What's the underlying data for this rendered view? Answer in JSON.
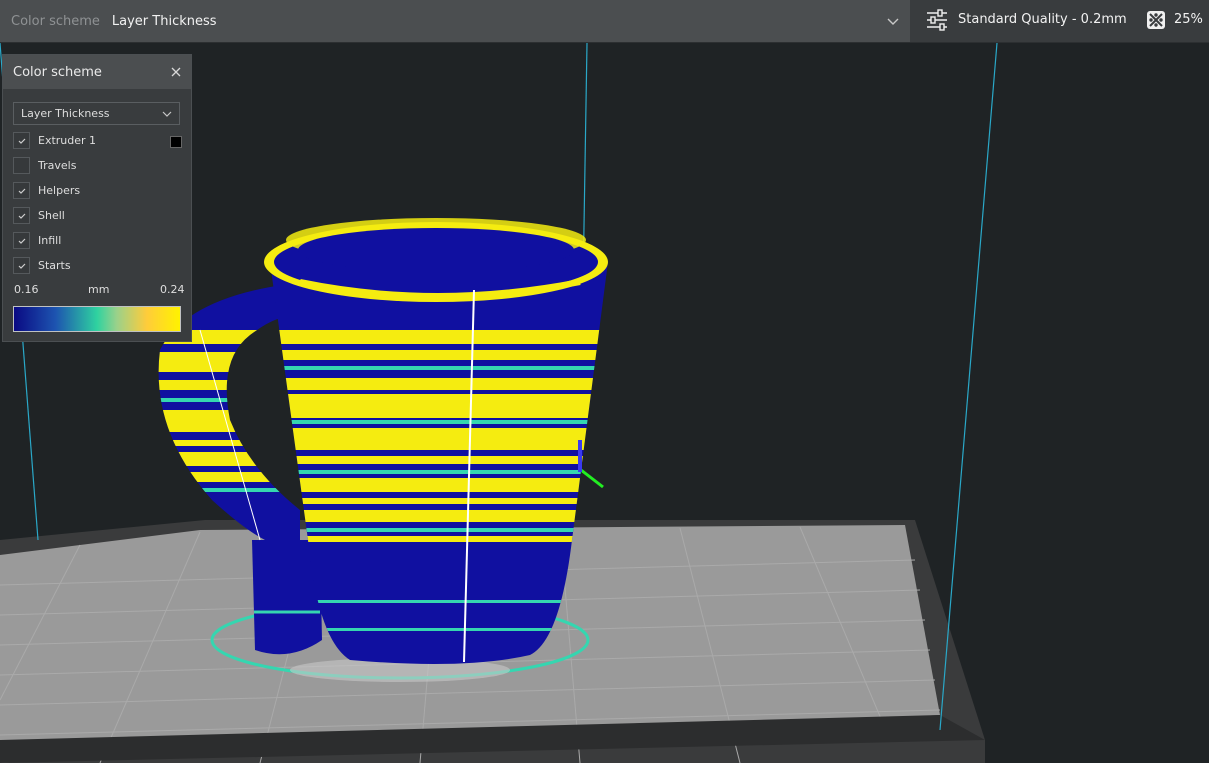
{
  "header": {
    "color_scheme_label": "Color scheme",
    "color_scheme_value": "Layer Thickness",
    "quality_label": "Standard Quality - 0.2mm",
    "infill_label": "25%"
  },
  "panel": {
    "title": "Color scheme",
    "dropdown_value": "Layer Thickness",
    "options": [
      {
        "label": "Extruder 1",
        "checked": true
      },
      {
        "label": "Travels",
        "checked": false
      },
      {
        "label": "Helpers",
        "checked": true
      },
      {
        "label": "Shell",
        "checked": true
      },
      {
        "label": "Infill",
        "checked": true
      },
      {
        "label": "Starts",
        "checked": true
      }
    ],
    "extruder_color": "#000000",
    "legend": {
      "min": "0.16",
      "unit": "mm",
      "max": "0.24"
    }
  },
  "colors": {
    "layer_thin": "#1010a0",
    "layer_thick": "#f5ec10",
    "layer_mid": "#35d6b0",
    "build_plate": "#9b9b9b",
    "volume_edge": "#2aa8c8",
    "background": "#1f2325"
  },
  "icons": {
    "settings": "sliders-icon",
    "infill": "infill-pattern-icon",
    "close": "close-icon",
    "chevron": "chevron-down-icon",
    "check": "check-icon"
  }
}
